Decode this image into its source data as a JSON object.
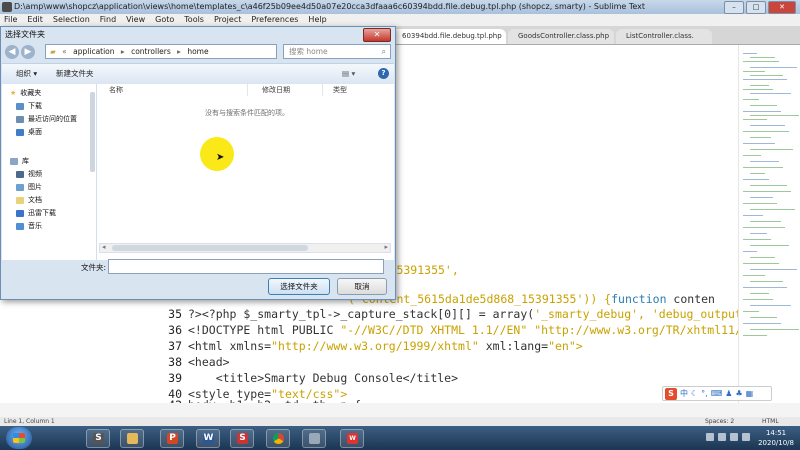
{
  "window": {
    "title": "D:\\amp\\www\\shopcz\\application\\views\\home\\templates_c\\a46f25b09ee4d50a07e20cca3dfaaa6c60394bdd.file.debug.tpl.php (shopcz, smarty) - Sublime Text"
  },
  "menu": [
    "File",
    "Edit",
    "Selection",
    "Find",
    "View",
    "Goto",
    "Tools",
    "Project",
    "Preferences",
    "Help"
  ],
  "tabs": [
    {
      "label": "60394bdd.file.debug.tpl.php",
      "active": true
    },
    {
      "label": "GoodsController.class.php",
      "active": false
    },
    {
      "label": "ListController.class.",
      "active": false
    }
  ],
  "code_lines": [
    {
      "num": "",
      "parts": [
        "",
        "5d868_15391355',",
        "",
        ""
      ]
    },
    {
      "num": "",
      "parts": [
        "",
        "'/?>",
        "",
        ""
      ]
    },
    {
      "num": "",
      "parts": [
        "",
        "('content_5615da1de5d868_15391355')) {",
        "function",
        " conten"
      ]
    },
    {
      "num": "35",
      "parts": [
        "?><?php $_smarty_tpl->_capture_stack[0][] = array(",
        "'_smarty_debug', 'debug_output', nul",
        "",
        ""
      ]
    },
    {
      "num": "36",
      "parts": [
        "<!DOCTYPE html PUBLIC ",
        "\"-//W3C//DTD XHTML 1.1//EN\" \"http://www.w3.org/TR/xhtml11/DTD/xh",
        "",
        ""
      ]
    },
    {
      "num": "37",
      "parts": [
        "<html xmlns=",
        "\"http://www.w3.org/1999/xhtml\"",
        " xml:lang=",
        "\"en\">"
      ]
    },
    {
      "num": "38",
      "parts": [
        "<head>",
        "",
        "",
        ""
      ]
    },
    {
      "num": "39",
      "parts": [
        "    <title>Smarty Debug Console</title>",
        "",
        "",
        ""
      ]
    },
    {
      "num": "40",
      "parts": [
        "<style type=",
        "\"text/css\">",
        "",
        ""
      ]
    },
    {
      "num": "41",
      "parts": [
        "",
        "",
        "",
        ""
      ]
    },
    {
      "num": "42",
      "parts": [
        "body, h1, h2, td, th, p {",
        "",
        "",
        ""
      ]
    }
  ],
  "status": {
    "position": "Line 1, Column 1",
    "spaces": "Spaces: 2",
    "syntax": "HTML"
  },
  "ime": {
    "logo": "S",
    "mode": "中"
  },
  "dialog": {
    "title": "选择文件夹",
    "close": "✕",
    "path": [
      "application",
      "controllers",
      "home"
    ],
    "search_placeholder": "搜索 home",
    "toolbar": {
      "organize": "组织 ▾",
      "new_folder": "新建文件夹"
    },
    "nav_groups": [
      {
        "label": "收藏夹",
        "items": [
          "下载",
          "最近访问的位置",
          "桌面"
        ]
      },
      {
        "label": "库",
        "items": [
          "视频",
          "图片",
          "文档",
          "迅雷下载",
          "音乐"
        ]
      }
    ],
    "columns": [
      "名称",
      "修改日期",
      "类型"
    ],
    "empty_message": "没有与搜索条件匹配的项。",
    "filename_label": "文件夹:",
    "select_button": "选择文件夹",
    "cancel_button": "取消"
  },
  "taskbar": {
    "time": "14:51",
    "date": "2020/10/8",
    "apps": [
      "sublime",
      "folder",
      "powerpoint",
      "word",
      "chrome",
      "generic",
      "wps"
    ]
  }
}
